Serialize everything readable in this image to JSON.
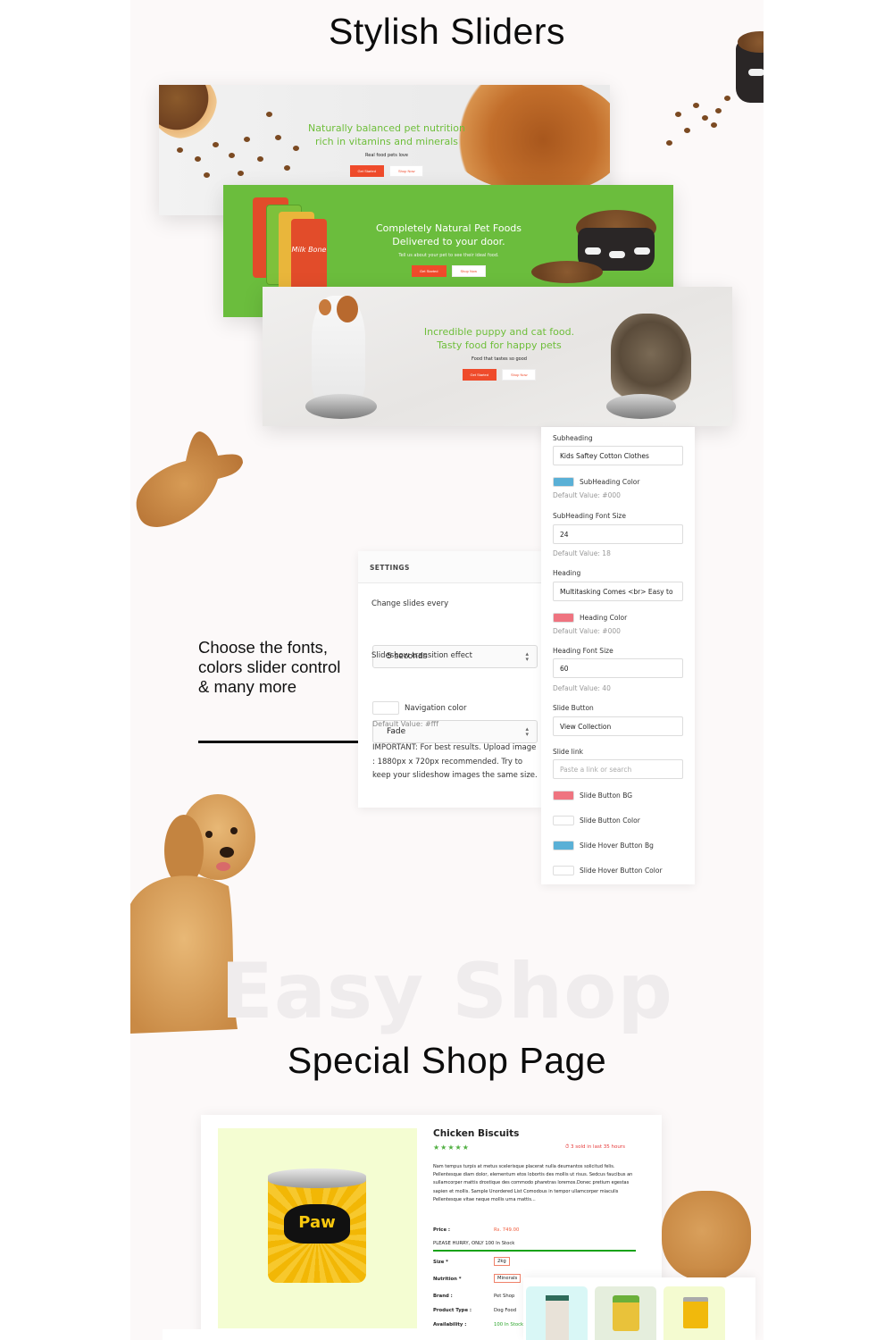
{
  "titles": {
    "sliders": "Stylish Sliders",
    "watermark": "Easy Shop",
    "shop": "Special Shop Page"
  },
  "slides": [
    {
      "heading_line1": "Naturally balanced pet nutrition",
      "heading_line2": "rich in vitamins and minerals",
      "tagline": "Real food pets love",
      "primary_button": "Get Started",
      "secondary_button": "Shop Now",
      "background_color": "#ececec",
      "heading_color": "#6ebe3a"
    },
    {
      "heading_line1": "Completely Natural Pet Foods",
      "heading_line2": "Delivered to your door.",
      "tagline": "Tell us about your pet to see their ideal food.",
      "primary_button": "Get Started",
      "secondary_button": "Shop Now",
      "background_color": "#6bbd3d",
      "heading_color": "#ffffff",
      "pouch_label": "Milk Bone"
    },
    {
      "heading_line1": "Incredible puppy and cat food.",
      "heading_line2": "Tasty food for happy pets",
      "tagline": "Food that tastes so good",
      "primary_button": "Get Started",
      "secondary_button": "Shop Now",
      "background_color": "#ebe9e7",
      "heading_color": "#6ebe3a"
    }
  ],
  "feature": {
    "text": "Choose the fonts, colors slider control & many more"
  },
  "settings_panel": {
    "header": "SETTINGS",
    "change_slides_label": "Change slides every",
    "change_slides_value": "5 seconds",
    "transition_label": "Slideshow transition effect",
    "transition_value": "Fade",
    "nav_color_label": "Navigation color",
    "nav_color_swatch": "#ffffff",
    "nav_color_default": "Default Value: #fff",
    "important_note": "IMPORTANT: For best results. Upload image : 1880px x 720px recommended. Try to keep your slideshow images the same size."
  },
  "properties_panel": {
    "subheading_label": "Subheading",
    "subheading_value": "Kids Saftey Cotton Clothes",
    "subheading_color_label": "SubHeading Color",
    "subheading_color_swatch": "#5ab0d6",
    "subheading_color_default": "Default Value: #000",
    "subheading_size_label": "SubHeading Font Size",
    "subheading_size_value": "24",
    "subheading_size_default": "Default Value: 18",
    "heading_label": "Heading",
    "heading_value": "Multitasking Comes <br> Easy to",
    "heading_color_label": "Heading Color",
    "heading_color_swatch": "#ef7480",
    "heading_color_default": "Default Value: #000",
    "heading_size_label": "Heading Font Size",
    "heading_size_value": "60",
    "heading_size_default": "Default Value: 40",
    "slide_button_label": "Slide Button",
    "slide_button_value": "View Collection",
    "slide_link_label": "Slide link",
    "slide_link_placeholder": "Paste a link or search",
    "colors": [
      {
        "label": "Slide Button BG",
        "swatch": "#ef7480"
      },
      {
        "label": "Slide Button Color",
        "swatch": "#ffffff"
      },
      {
        "label": "Slide Hover Button Bg",
        "swatch": "#5ab0d6"
      },
      {
        "label": "Slide Hover Button Color",
        "swatch": "#ffffff"
      }
    ]
  },
  "product": {
    "title": "Chicken Biscuits",
    "rating": 5,
    "stars": "★★★★★",
    "sold_notice": "3 sold in last 35 hours",
    "description": "Nam tempus turpis at metus scelerisque placerat nulla deumantos solicitud felis. Pellentesque diam dolor, elementum etos lobortis des mollis ut risus. Sedcus faucibus an sullamcorper mattis drostique des commodo pharetras loremos.Donec pretium egestas sapien et mollis. Sample Unordered List Comodous in tempor ullamcorper miaculis Pellentesque vitae neque mollis urna mattis...",
    "price_label": "Price :",
    "price_value": "Rs. 749.00",
    "hurry_notice": "PLEASE HURRY, ONLY 100 In Stock",
    "size_label": "Size *",
    "size_value": "2kg",
    "nutrition_label": "Nutrition *",
    "nutrition_value": "Minerals",
    "brand_label": "Brand :",
    "brand_value": "Pet Shop",
    "type_label": "Product Type :",
    "type_value": "Dog Food",
    "availability_label": "Availability :",
    "availability_value": "100 In Stock",
    "tin_brand": "Paw",
    "thumbnail_colors": [
      "#d9f7f6",
      "#e5eedd",
      "#f4fbd0"
    ]
  }
}
